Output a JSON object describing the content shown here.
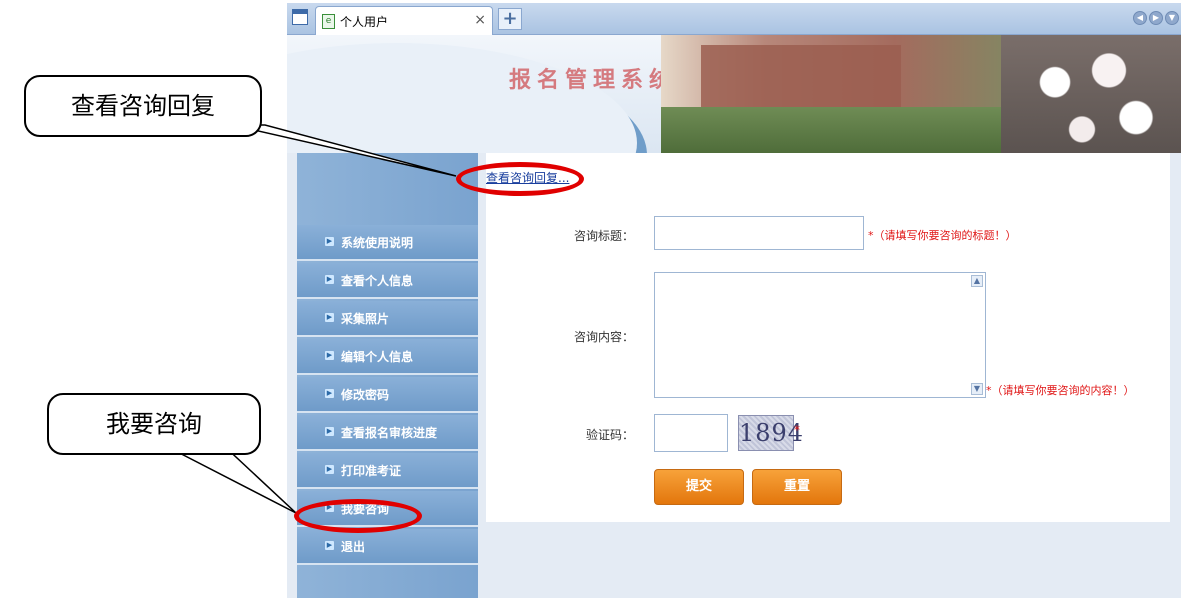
{
  "browser": {
    "tab_label": "个人用户",
    "tab_close": "×",
    "new_tab": "+",
    "controls": [
      "◀",
      "▶",
      "▼"
    ]
  },
  "banner": {
    "title": "报名管理系统"
  },
  "sidebar": {
    "items": [
      {
        "label": "系统使用说明"
      },
      {
        "label": "查看个人信息"
      },
      {
        "label": "采集照片"
      },
      {
        "label": "编辑个人信息"
      },
      {
        "label": "修改密码"
      },
      {
        "label": "查看报名审核进度"
      },
      {
        "label": "打印准考证"
      },
      {
        "label": "我要咨询"
      },
      {
        "label": "退出"
      }
    ]
  },
  "content": {
    "reply_link": "查看咨询回复...",
    "title_label": "咨询标题：",
    "title_value": "",
    "title_hint": "*（请填写你要咨询的标题！）",
    "body_label": "咨询内容：",
    "body_value": "",
    "body_hint": "*（请填写你要咨询的内容！）",
    "captcha_label": "验证码：",
    "captcha_value": "",
    "captcha_code": "1894",
    "captcha_star": "*",
    "submit": "提交",
    "reset": "重置"
  },
  "annotations": {
    "callout_reply": "查看咨询回复",
    "callout_consult": "我要咨询",
    "highlight_color": "#e00000"
  }
}
